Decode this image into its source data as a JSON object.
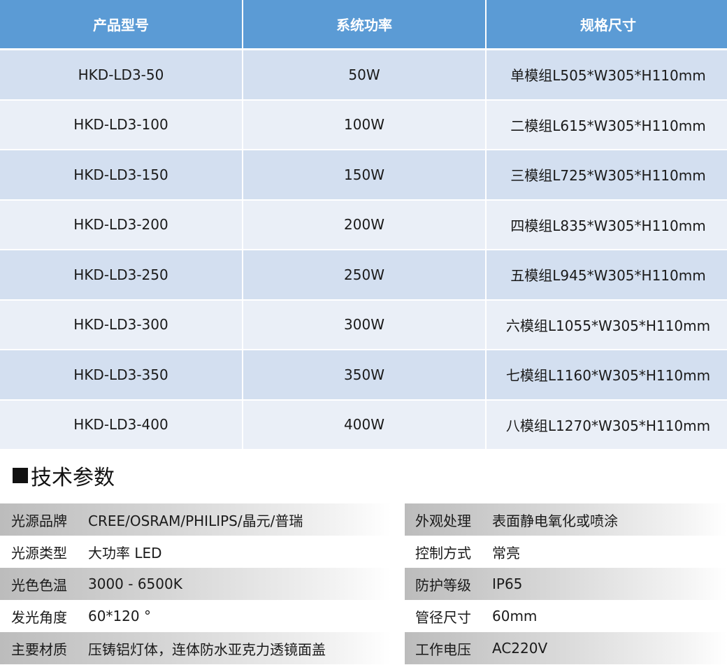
{
  "model_table": {
    "headers": [
      "产品型号",
      "系统功率",
      "规格尺寸"
    ],
    "rows": [
      {
        "model": "HKD-LD3-50",
        "power": "50W",
        "size": "单模组L505*W305*H110mm"
      },
      {
        "model": "HKD-LD3-100",
        "power": "100W",
        "size": "二模组L615*W305*H110mm"
      },
      {
        "model": "HKD-LD3-150",
        "power": "150W",
        "size": "三模组L725*W305*H110mm"
      },
      {
        "model": "HKD-LD3-200",
        "power": "200W",
        "size": "四模组L835*W305*H110mm"
      },
      {
        "model": "HKD-LD3-250",
        "power": "250W",
        "size": "五模组L945*W305*H110mm"
      },
      {
        "model": "HKD-LD3-300",
        "power": "300W",
        "size": "六模组L1055*W305*H110mm"
      },
      {
        "model": "HKD-LD3-350",
        "power": "350W",
        "size": "七模组L1160*W305*H110mm"
      },
      {
        "model": "HKD-LD3-400",
        "power": "400W",
        "size": "八模组L1270*W305*H110mm"
      }
    ]
  },
  "section": {
    "title": "技术参数"
  },
  "specs": {
    "left": [
      {
        "label": "光源品牌",
        "value": "CREE/OSRAM/PHILIPS/晶元/普瑞"
      },
      {
        "label": "光源类型",
        "value": "大功率 LED"
      },
      {
        "label": "光色色温",
        "value": "3000 - 6500K"
      },
      {
        "label": "发光角度",
        "value": "60*120 °"
      },
      {
        "label": "主要材质",
        "value": "压铸铝灯体，连体防水亚克力透镜面盖"
      }
    ],
    "right": [
      {
        "label": "外观处理",
        "value": "表面静电氧化或喷涂"
      },
      {
        "label": "控制方式",
        "value": "常亮"
      },
      {
        "label": "防护等级",
        "value": "IP65"
      },
      {
        "label": "管径尺寸",
        "value": "60mm"
      },
      {
        "label": "工作电压",
        "value": "AC220V"
      }
    ]
  },
  "colors": {
    "header_bg": "#5b9bd5",
    "row_odd_bg": "#d3dff0",
    "row_even_bg": "#eaeff7",
    "spec_shade": "#bcbcbc"
  }
}
